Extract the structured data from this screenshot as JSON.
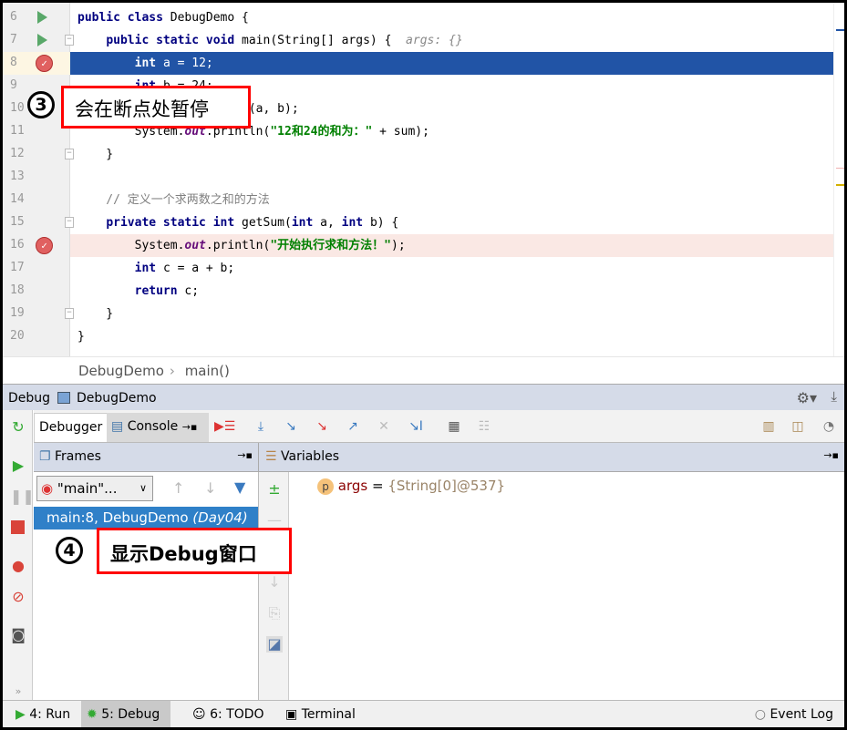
{
  "editor": {
    "lines": [
      {
        "n": "6",
        "run": true,
        "fold": false,
        "tokens": [
          [
            "kw",
            "public class "
          ],
          [
            "",
            "DebugDemo {"
          ]
        ]
      },
      {
        "n": "7",
        "run": true,
        "fold": true,
        "tokens": [
          [
            "",
            "    "
          ],
          [
            "kw",
            "public static void "
          ],
          [
            "",
            "main(String[] args) {  "
          ],
          [
            "hint",
            "args: {}"
          ]
        ]
      },
      {
        "n": "8",
        "bp": true,
        "cur": true,
        "tokens": [
          [
            "",
            "        "
          ],
          [
            "kw",
            "int "
          ],
          [
            "",
            "a = 12;"
          ]
        ]
      },
      {
        "n": "9",
        "tokens": [
          [
            "",
            "        "
          ],
          [
            "kw",
            "int "
          ],
          [
            "",
            "b = 24;"
          ]
        ]
      },
      {
        "n": "10",
        "tokens": [
          [
            "",
            "        "
          ],
          [
            "kw",
            "int "
          ],
          [
            "",
            "sum = getSum(a, b);"
          ]
        ]
      },
      {
        "n": "11",
        "tokens": [
          [
            "",
            "        System."
          ],
          [
            "fld",
            "out"
          ],
          [
            "",
            ".println("
          ],
          [
            "st",
            "\"12和24的和为：\""
          ],
          [
            "",
            " + sum);"
          ]
        ]
      },
      {
        "n": "12",
        "fold": true,
        "tokens": [
          [
            "",
            "    }"
          ]
        ]
      },
      {
        "n": "13",
        "tokens": []
      },
      {
        "n": "14",
        "tokens": [
          [
            "cm",
            "    // 定义一个求两数之和的方法"
          ]
        ]
      },
      {
        "n": "15",
        "fold": true,
        "tokens": [
          [
            "",
            "    "
          ],
          [
            "kw",
            "private static int "
          ],
          [
            "",
            "getSum("
          ],
          [
            "kw",
            "int "
          ],
          [
            "",
            "a, "
          ],
          [
            "kw",
            "int "
          ],
          [
            "",
            "b) {"
          ]
        ]
      },
      {
        "n": "16",
        "bp": true,
        "bpl": true,
        "tokens": [
          [
            "",
            "        System."
          ],
          [
            "fld",
            "out"
          ],
          [
            "",
            ".println("
          ],
          [
            "st",
            "\"开始执行求和方法！\""
          ],
          [
            "",
            ");"
          ]
        ]
      },
      {
        "n": "17",
        "tokens": [
          [
            "",
            "        "
          ],
          [
            "kw",
            "int "
          ],
          [
            "",
            "c = a + b;"
          ]
        ]
      },
      {
        "n": "18",
        "tokens": [
          [
            "",
            "        "
          ],
          [
            "kw",
            "return "
          ],
          [
            "",
            "c;"
          ]
        ]
      },
      {
        "n": "19",
        "fold": true,
        "tokens": [
          [
            "",
            "    }"
          ]
        ]
      },
      {
        "n": "20",
        "tokens": [
          [
            "",
            "}"
          ]
        ]
      }
    ]
  },
  "breadcrumb": [
    "DebugDemo",
    "main()"
  ],
  "debug_header": {
    "title": "Debug",
    "config": "DebugDemo"
  },
  "tabs": {
    "debugger": "Debugger",
    "console": "Console"
  },
  "panes": {
    "frames": "Frames",
    "variables": "Variables"
  },
  "frames": {
    "thread": "\"main\"...",
    "items": [
      {
        "label": "main:8, DebugDemo",
        "module": "(Day04)"
      }
    ]
  },
  "variables": [
    {
      "badge": "p",
      "name": "args",
      "eq": " = ",
      "value": "{String[0]@537}"
    }
  ],
  "bottom": {
    "run": "4: Run",
    "debug": "5: Debug",
    "todo": "6: TODO",
    "terminal": "Terminal",
    "event_log": "Event Log"
  },
  "callouts": {
    "c3": {
      "num": "3",
      "text": "会在断点处暂停"
    },
    "c4": {
      "num": "4",
      "text": "显示Debug窗口"
    }
  },
  "colors": {
    "current_line": "#2154a6",
    "breakpoint": "#e06060",
    "callout_border": "#ff0000"
  }
}
